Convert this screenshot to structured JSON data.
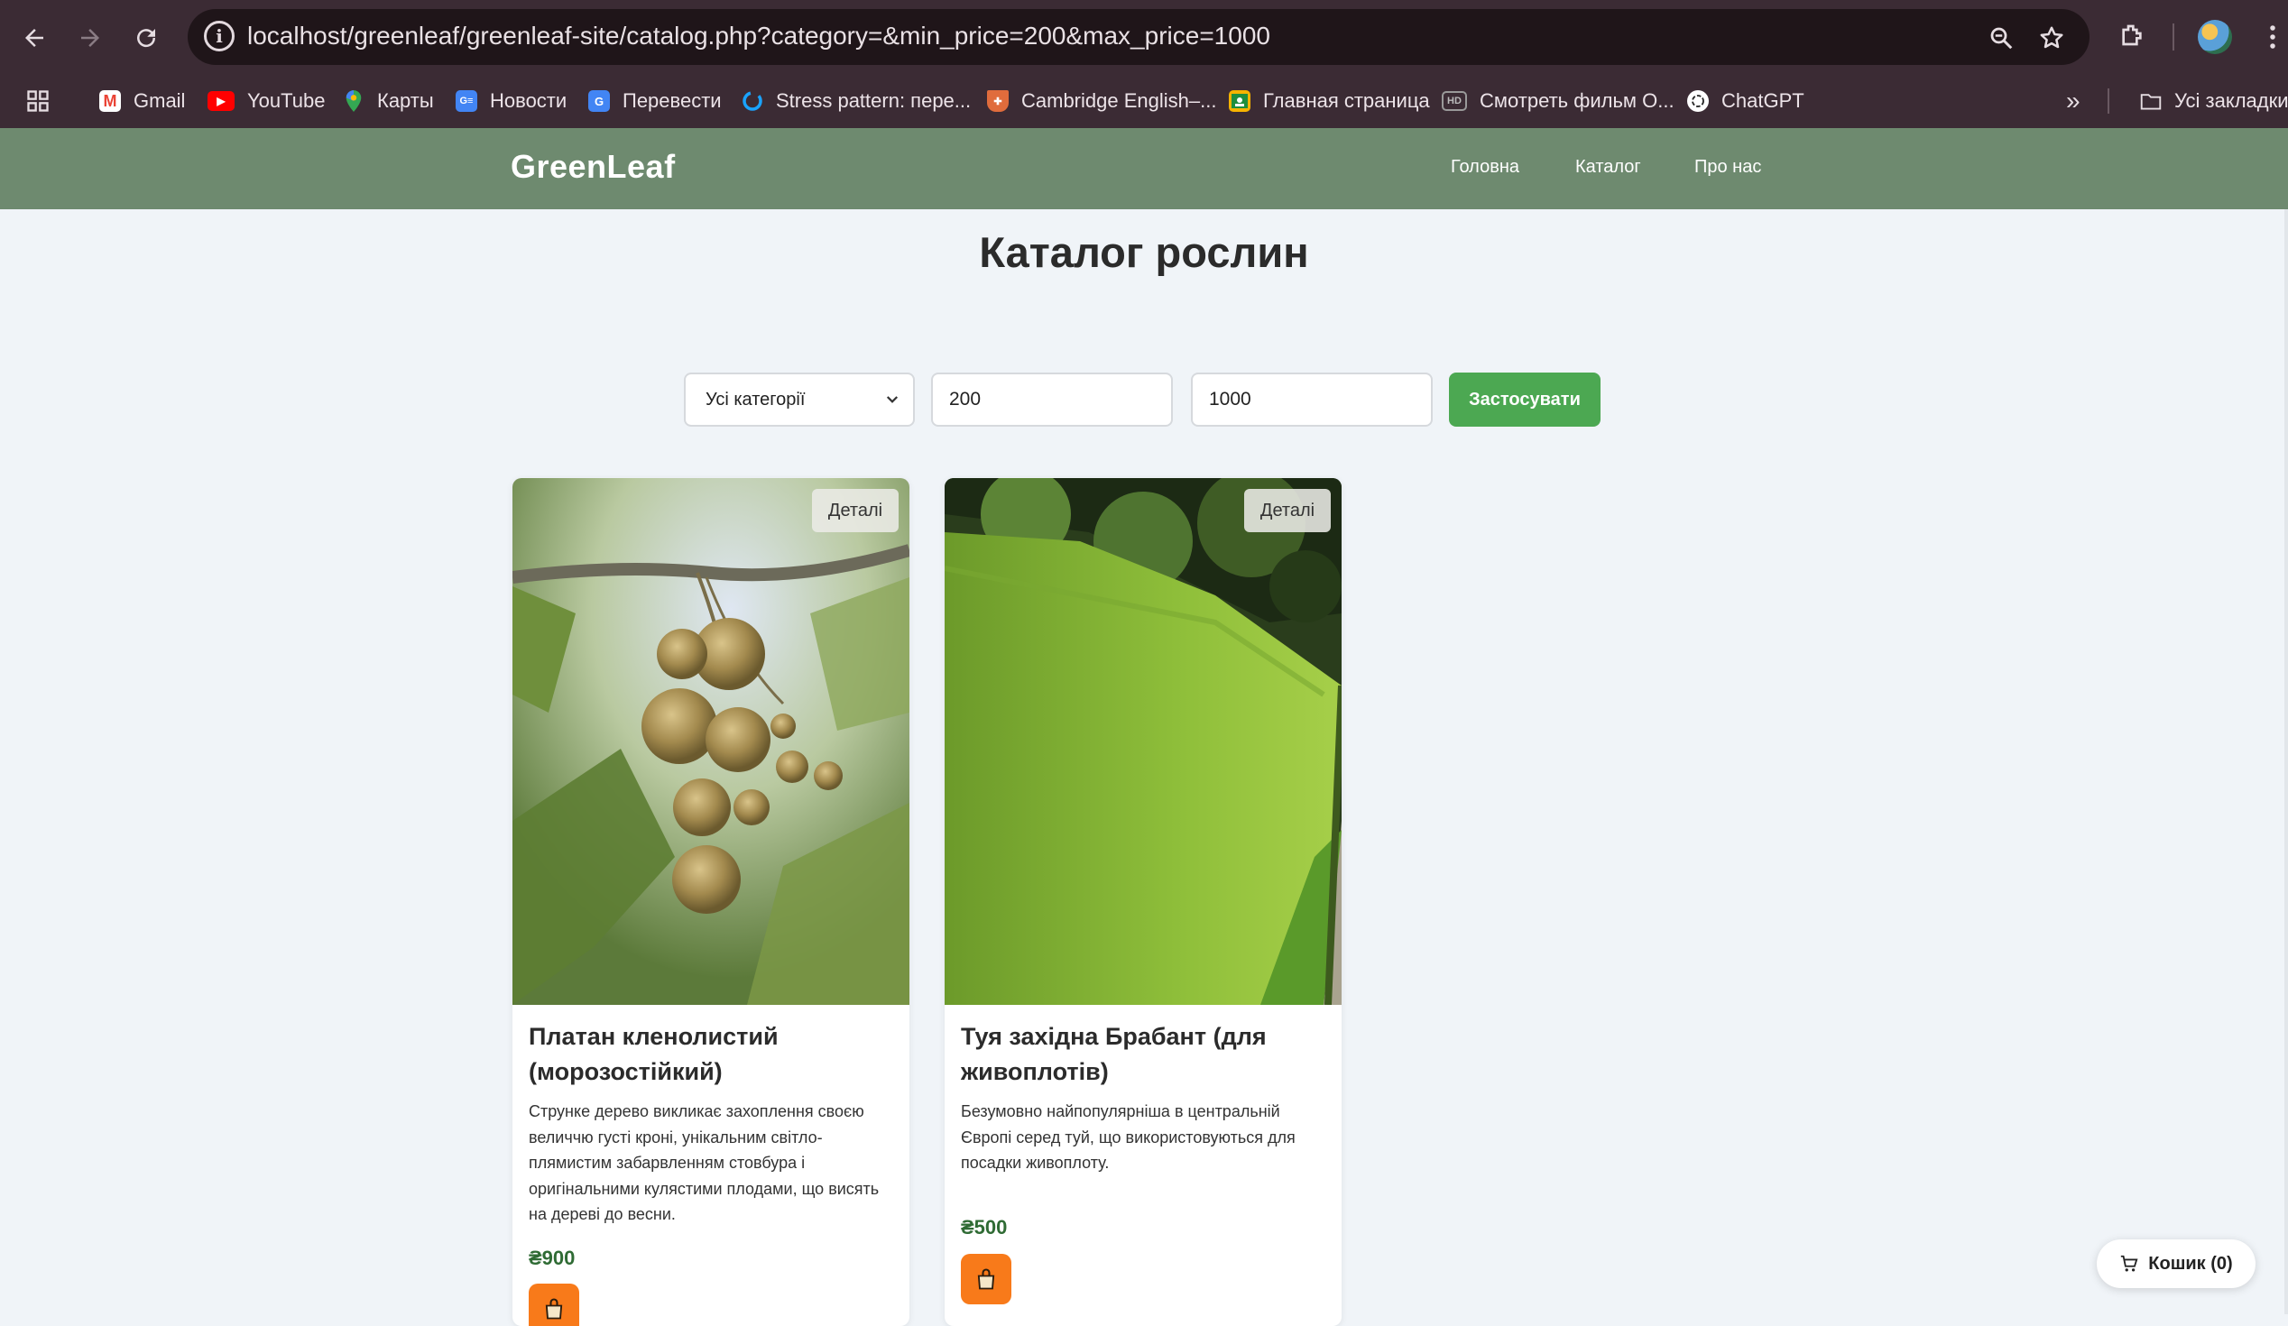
{
  "browser": {
    "url": "localhost/greenleaf/greenleaf-site/catalog.php?category=&min_price=200&max_price=1000",
    "bookmarks": [
      {
        "label": "Gmail",
        "icon": "gmail-icon",
        "color": "#ea4335"
      },
      {
        "label": "YouTube",
        "icon": "youtube-icon",
        "color": "#ff0000"
      },
      {
        "label": "Карты",
        "icon": "maps-pin-icon",
        "color": "#34a853"
      },
      {
        "label": "Новости",
        "icon": "news-icon",
        "color": "#4285f4"
      },
      {
        "label": "Перевести",
        "icon": "translate-icon",
        "color": "#4285f4"
      },
      {
        "label": "Stress pattern: пере...",
        "icon": "loop-icon",
        "color": "#1aa3ff"
      },
      {
        "label": "Cambridge English–...",
        "icon": "cambridge-shield-icon",
        "color": "#e06c3c"
      },
      {
        "label": "Главная страница",
        "icon": "classroom-icon",
        "color": "#f6b300"
      },
      {
        "label": "Смотреть фильм О...",
        "icon": "hd-icon",
        "color": "#888888"
      },
      {
        "label": "ChatGPT",
        "icon": "chatgpt-icon",
        "color": "#ffffff"
      }
    ],
    "all_bookmarks_label": "Усі закладки"
  },
  "site": {
    "logo": "GreenLeaf",
    "nav": [
      "Головна",
      "Каталог",
      "Про нас"
    ]
  },
  "page": {
    "title": "Каталог рослин"
  },
  "filters": {
    "category_selected": "Усі категорії",
    "min_price": "200",
    "max_price": "1000",
    "apply_label": "Застосувати"
  },
  "products": [
    {
      "details_label": "Деталі",
      "title": "Платан кленолистий (морозостійкий)",
      "description": "Струнке дерево викликає захоплення своєю величчю густі кроні, унікальним світло-плямистим забарвленням стовбура і оригінальними кулястими плодами, що висять на дереві до весни.",
      "price": "₴900"
    },
    {
      "details_label": "Деталі",
      "title": "Туя західна Брабант (для живоплотів)",
      "description": "Безумовно найпопулярніша в центральній Європі серед туй, що використовуються для посадки живоплоту.",
      "price": "₴500"
    }
  ],
  "cart": {
    "label": "Кошик (0)"
  },
  "colors": {
    "header_bg": "#6e8a6f",
    "apply_button": "#4ca852",
    "price_text": "#2f6b34",
    "add_to_cart": "#f87a1a",
    "page_bg": "#f0f4f8"
  }
}
